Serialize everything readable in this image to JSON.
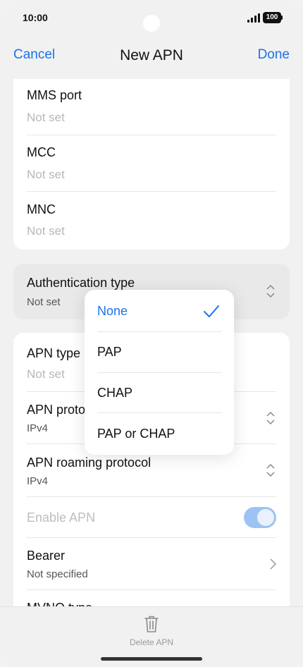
{
  "status_bar": {
    "time": "10:00",
    "battery": "100"
  },
  "header": {
    "cancel": "Cancel",
    "title": "New APN",
    "done": "Done"
  },
  "top_fields": [
    {
      "label": "MMS port",
      "value": "Not set"
    },
    {
      "label": "MCC",
      "value": "Not set"
    },
    {
      "label": "MNC",
      "value": "Not set"
    }
  ],
  "auth": {
    "label": "Authentication type",
    "value": "Not set"
  },
  "lower_fields": {
    "apn_type": {
      "label": "APN type",
      "value": "Not set"
    },
    "apn_protocol": {
      "label": "APN protocol",
      "value": "IPv4"
    },
    "apn_roaming": {
      "label": "APN roaming protocol",
      "value": "IPv4"
    },
    "enable_apn": {
      "label": "Enable APN",
      "enabled": true
    },
    "bearer": {
      "label": "Bearer",
      "value": "Not specified"
    },
    "mvno": {
      "label": "MVNO type"
    }
  },
  "auth_menu": {
    "options": [
      "None",
      "PAP",
      "CHAP",
      "PAP or CHAP"
    ],
    "selected": "None"
  },
  "bottom": {
    "delete_label": "Delete APN"
  },
  "colors": {
    "accent": "#1a73e8",
    "toggle": "#9cc4f2"
  }
}
